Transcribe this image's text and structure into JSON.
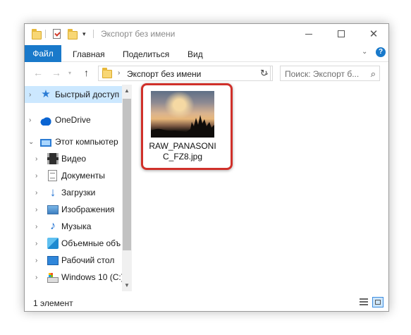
{
  "window": {
    "title": "Экспорт без имени"
  },
  "ribbon": {
    "tabs": [
      "Файл",
      "Главная",
      "Поделиться",
      "Вид"
    ],
    "accent_color": "#1979ca"
  },
  "address": {
    "path": "Экспорт без имени",
    "search_placeholder": "Поиск: Экспорт б..."
  },
  "nav": {
    "items": [
      {
        "label": "Быстрый доступ",
        "icon": "star-icon"
      },
      {
        "label": "OneDrive",
        "icon": "cloud-icon"
      },
      {
        "label": "Этот компьютер",
        "icon": "computer-icon"
      },
      {
        "label": "Видео",
        "icon": "video-icon"
      },
      {
        "label": "Документы",
        "icon": "documents-icon"
      },
      {
        "label": "Загрузки",
        "icon": "downloads-icon"
      },
      {
        "label": "Изображения",
        "icon": "pictures-icon"
      },
      {
        "label": "Музыка",
        "icon": "music-icon"
      },
      {
        "label": "Объемные объ",
        "icon": "3d-objects-icon"
      },
      {
        "label": "Рабочий стол",
        "icon": "desktop-icon"
      },
      {
        "label": "Windows 10 (C:)",
        "icon": "drive-icon"
      }
    ]
  },
  "content": {
    "files": [
      {
        "name": "RAW_PANASONIC_FZ8.jpg",
        "line1": "RAW_PANASONI",
        "line2": "C_FZ8.jpg",
        "thumbnail": "sunset-thumbnail"
      }
    ],
    "highlight_color": "#d0302a"
  },
  "status": {
    "count": "1 элемент"
  }
}
